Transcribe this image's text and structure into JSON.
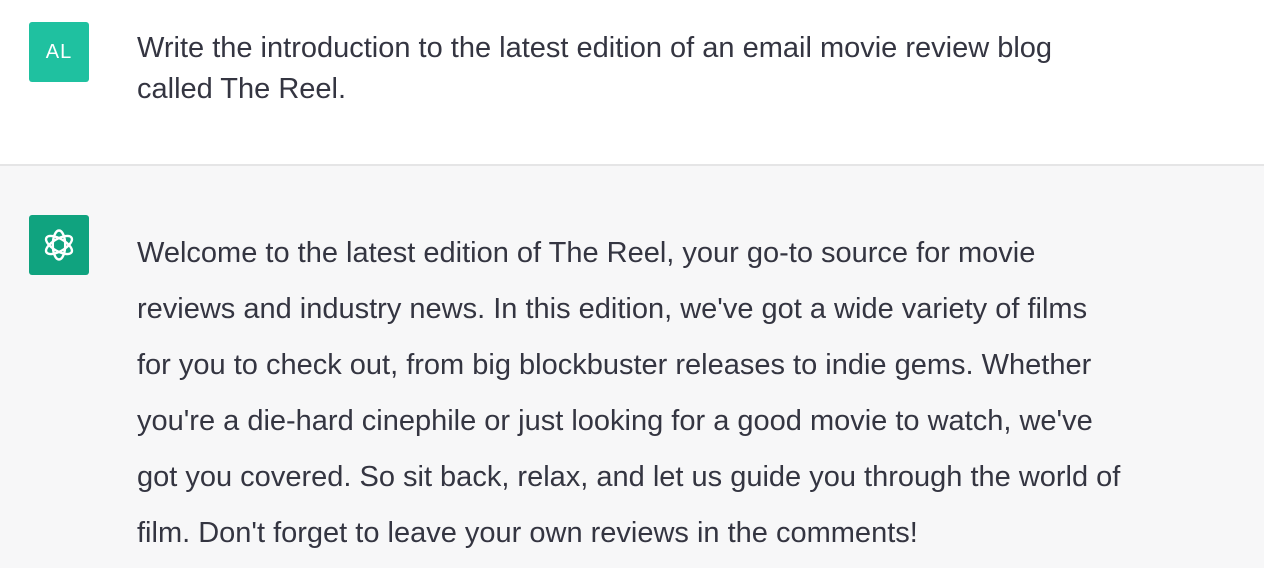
{
  "user": {
    "avatar_initials": "AL",
    "avatar_color": "#1fc1a0",
    "message": "Write the introduction to the latest edition of an email movie review blog\ncalled The Reel."
  },
  "assistant": {
    "avatar_icon": "openai-logo-icon",
    "avatar_color": "#10a37f",
    "message": "Welcome to the latest edition of The Reel, your go-to source for movie\nreviews and industry news. In this edition, we've got a wide variety of films\nfor you to check out, from big blockbuster releases to indie gems. Whether\nyou're a die-hard cinephile or just looking for a good movie to watch, we've\ngot you covered. So sit back, relax, and let us guide you through the world of\nfilm. Don't forget to leave your own reviews in the comments!"
  },
  "colors": {
    "text": "#343541",
    "assistant_background": "#f7f7f8",
    "divider": "#e5e5e6"
  }
}
